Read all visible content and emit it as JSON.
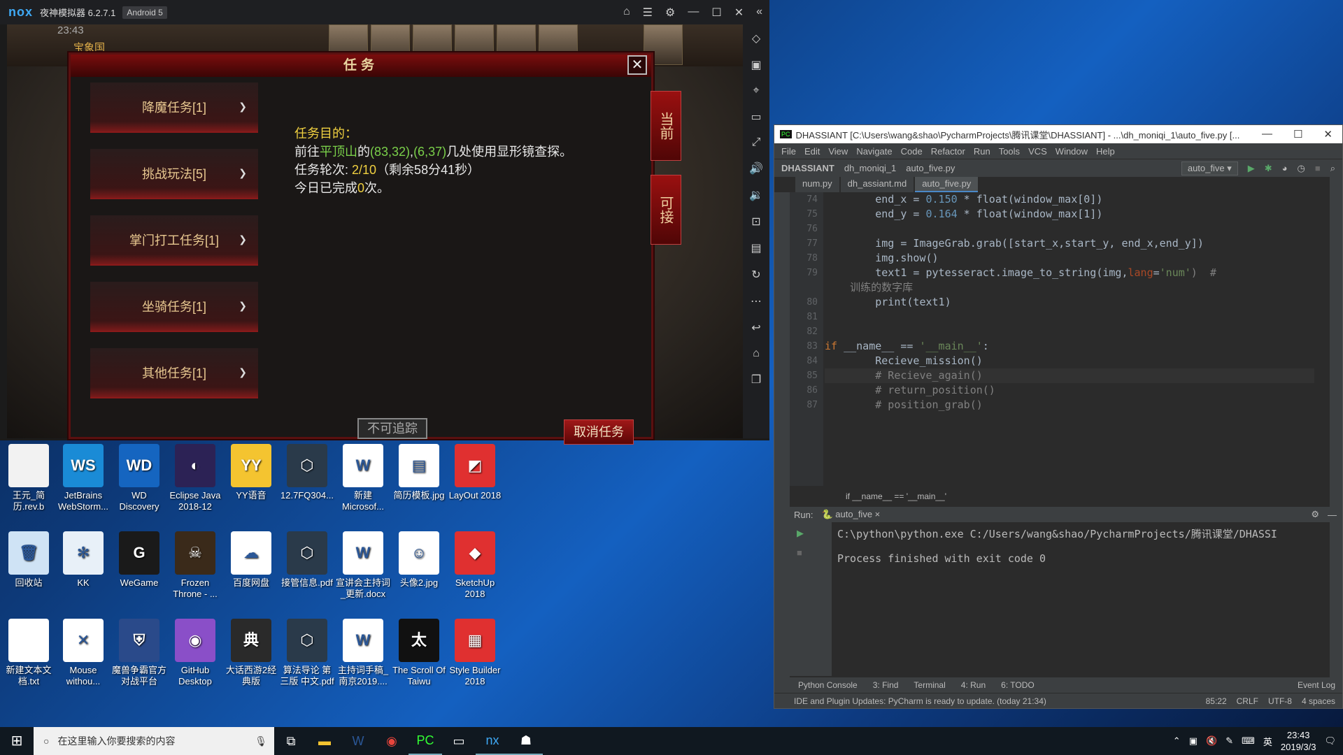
{
  "nox": {
    "logo": "nox",
    "title": "夜神模拟器 6.2.7.1",
    "android": "Android 5"
  },
  "game": {
    "time": "23:43",
    "place": "宝象国",
    "dialog_title": "任务",
    "close": "✕",
    "tabs": [
      "降魔任务[1]",
      "挑战玩法[5]",
      "掌门打工任务[1]",
      "坐骑任务[1]",
      "其他任务[1]"
    ],
    "task": {
      "l1": "任务目的：",
      "l2a": "前往",
      "l2b": "平顶山",
      "l2c": "的",
      "l2d": "(83,32)",
      "l2e": ",",
      "l2f": "(6,37)",
      "l2g": "几处使用显形镜查探。",
      "l3a": "任务轮次: ",
      "l3b": "2/10",
      "l3c": "（剩余58分41秒）",
      "l4a": "今日已完成",
      "l4b": "0",
      "l4c": "次。"
    },
    "btn_untrack": "不可追踪",
    "btn_cancel": "取消任务",
    "side1": "当前",
    "side2": "可接"
  },
  "desktop": [
    {
      "label": "王元_简历.rev.b",
      "color": "#f2f2f2",
      "glyph": ""
    },
    {
      "label": "JetBrains WebStorm...",
      "color": "#1a8bd6",
      "glyph": "WS"
    },
    {
      "label": "WD Discovery",
      "color": "#1565c0",
      "glyph": "WD"
    },
    {
      "label": "Eclipse Java 2018-12",
      "color": "#2c2255",
      "glyph": "◐"
    },
    {
      "label": "YY语音",
      "color": "#f4c430",
      "glyph": "YY"
    },
    {
      "label": "12.7FQ304...",
      "color": "#2a3a4a",
      "glyph": "⬡"
    },
    {
      "label": "新建 Microsof...",
      "color": "#ffffff",
      "glyph": "W"
    },
    {
      "label": "简历模板.jpg",
      "color": "#ffffff",
      "glyph": "▤"
    },
    {
      "label": "LayOut 2018",
      "color": "#e03030",
      "glyph": "◩"
    },
    {
      "label": "回收站",
      "color": "#cfe3f5",
      "glyph": "🗑"
    },
    {
      "label": "KK",
      "color": "#e8f0f8",
      "glyph": "✻"
    },
    {
      "label": "WeGame",
      "color": "#1a1a1a",
      "glyph": "G"
    },
    {
      "label": "Frozen Throne - ...",
      "color": "#3a2a1a",
      "glyph": "☠"
    },
    {
      "label": "百度网盘",
      "color": "#ffffff",
      "glyph": "☁"
    },
    {
      "label": "接管信息.pdf",
      "color": "#2a3a4a",
      "glyph": "⬡"
    },
    {
      "label": "宣讲会主持词_更新.docx",
      "color": "#ffffff",
      "glyph": "W"
    },
    {
      "label": "头像2.jpg",
      "color": "#ffffff",
      "glyph": "☺"
    },
    {
      "label": "SketchUp 2018",
      "color": "#e03030",
      "glyph": "◆"
    },
    {
      "label": "新建文本文档.txt",
      "color": "#ffffff",
      "glyph": ""
    },
    {
      "label": "Mouse withou...",
      "color": "#ffffff",
      "glyph": "✕"
    },
    {
      "label": "魔兽争霸官方对战平台",
      "color": "#2a4a8a",
      "glyph": "⛨"
    },
    {
      "label": "GitHub Desktop",
      "color": "#8a4fc8",
      "glyph": "◉"
    },
    {
      "label": "大话西游2经典版",
      "color": "#2a2a2a",
      "glyph": "典"
    },
    {
      "label": "算法导论 第三版 中文.pdf",
      "color": "#2a3a4a",
      "glyph": "⬡"
    },
    {
      "label": "主持词手稿_南京2019....",
      "color": "#ffffff",
      "glyph": "W"
    },
    {
      "label": "The Scroll Of Taiwu",
      "color": "#111111",
      "glyph": "太"
    },
    {
      "label": "Style Builder 2018",
      "color": "#e03030",
      "glyph": "▦"
    }
  ],
  "pycharm": {
    "title": "DHASSIANT [C:\\Users\\wang&shao\\PycharmProjects\\腾讯课堂\\DHASSIANT] - ...\\dh_moniqi_1\\auto_five.py [...",
    "menu": [
      "File",
      "Edit",
      "View",
      "Navigate",
      "Code",
      "Refactor",
      "Run",
      "Tools",
      "VCS",
      "Window",
      "Help"
    ],
    "nav": [
      "DHASSIANT",
      "dh_moniqi_1",
      "auto_five.py"
    ],
    "config": "auto_five",
    "tabs": [
      "num.py",
      "dh_assiant.md",
      "auto_five.py"
    ],
    "lines": [
      "74",
      "75",
      "76",
      "77",
      "78",
      "79",
      "",
      "80",
      "81",
      "82",
      "83",
      "84",
      "85",
      "86",
      "87"
    ],
    "code": {
      "l74a": "        end_x = ",
      "l74b": "0.150",
      "l74c": " * float(window_max[0])",
      "l75a": "        end_y = ",
      "l75b": "0.164",
      "l75c": " * float(window_max[1])",
      "l77": "        img = ImageGrab.grab([start_x,start_y, end_x,end_y])",
      "l78": "        img.show()",
      "l79a": "        text1 = pytesseract.image_to_string(img,",
      "l79b": "lang",
      "l79c": "=",
      "l79d": "'num'",
      "l79e": ")  #",
      "l79f": "    训练的数字库",
      "l80": "        print(text1)",
      "l83a": "if",
      "l83b": " __name__ == ",
      "l83c": "'__main__'",
      "l83d": ":",
      "l84": "        Recieve_mission()",
      "l85": "        # Recieve_again()",
      "l86": "        # return_position()",
      "l87": "        # position_grab()"
    },
    "crumb": "if __name__ == '__main__'",
    "run_label": "Run:",
    "run_tab": "auto_five",
    "console1": "C:\\python\\python.exe C:/Users/wang&shao/PycharmProjects/腾讯课堂/DHASSI",
    "console2": "Process finished with exit code 0",
    "bottom": [
      "Python Console",
      "3: Find",
      "Terminal",
      "4: Run",
      "6: TODO"
    ],
    "event": "Event Log",
    "status": "IDE and Plugin Updates: PyCharm is ready to update. (today 21:34)",
    "pos": "85:22",
    "crlf": "CRLF",
    "enc": "UTF-8",
    "indent": "4 spaces"
  },
  "taskbar": {
    "search": "在这里输入你要搜索的内容",
    "time": "23:43",
    "date": "2019/3/3",
    "ime": "英"
  }
}
